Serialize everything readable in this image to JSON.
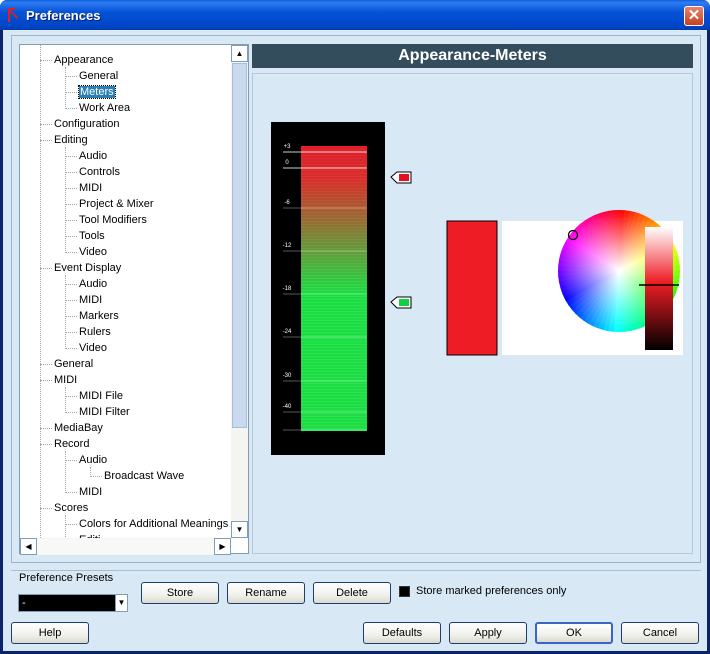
{
  "window": {
    "title": "Preferences",
    "close_symbol": "✕"
  },
  "tree": {
    "items": [
      {
        "label": "Appearance",
        "level": 1,
        "selected": false
      },
      {
        "label": "General",
        "level": 2,
        "selected": false
      },
      {
        "label": "Meters",
        "level": 2,
        "selected": true
      },
      {
        "label": "Work Area",
        "level": 2,
        "selected": false
      },
      {
        "label": "Configuration",
        "level": 1,
        "selected": false
      },
      {
        "label": "Editing",
        "level": 1,
        "selected": false
      },
      {
        "label": "Audio",
        "level": 2,
        "selected": false
      },
      {
        "label": "Controls",
        "level": 2,
        "selected": false
      },
      {
        "label": "MIDI",
        "level": 2,
        "selected": false
      },
      {
        "label": "Project & Mixer",
        "level": 2,
        "selected": false
      },
      {
        "label": "Tool Modifiers",
        "level": 2,
        "selected": false
      },
      {
        "label": "Tools",
        "level": 2,
        "selected": false
      },
      {
        "label": "Video",
        "level": 2,
        "selected": false
      },
      {
        "label": "Event Display",
        "level": 1,
        "selected": false
      },
      {
        "label": "Audio",
        "level": 2,
        "selected": false
      },
      {
        "label": "MIDI",
        "level": 2,
        "selected": false
      },
      {
        "label": "Markers",
        "level": 2,
        "selected": false
      },
      {
        "label": "Rulers",
        "level": 2,
        "selected": false
      },
      {
        "label": "Video",
        "level": 2,
        "selected": false
      },
      {
        "label": "General",
        "level": 1,
        "selected": false
      },
      {
        "label": "MIDI",
        "level": 1,
        "selected": false
      },
      {
        "label": "MIDI File",
        "level": 2,
        "selected": false
      },
      {
        "label": "MIDI Filter",
        "level": 2,
        "selected": false
      },
      {
        "label": "MediaBay",
        "level": 1,
        "selected": false
      },
      {
        "label": "Record",
        "level": 1,
        "selected": false
      },
      {
        "label": "Audio",
        "level": 2,
        "selected": false
      },
      {
        "label": "Broadcast Wave",
        "level": 3,
        "selected": false
      },
      {
        "label": "MIDI",
        "level": 2,
        "selected": false
      },
      {
        "label": "Scores",
        "level": 1,
        "selected": false
      },
      {
        "label": "Colors for Additional Meanings",
        "level": 2,
        "selected": false
      },
      {
        "label": "Editi",
        "level": 2,
        "selected": false
      }
    ]
  },
  "section": {
    "title": "Appearance-Meters"
  },
  "meter": {
    "scale_labels": [
      "+3",
      "0",
      "-6",
      "-12",
      "-18",
      "-24",
      "-30",
      "-40"
    ],
    "top_color": "#e8222e",
    "bottom_color": "#22e84a",
    "handles": [
      {
        "name": "top",
        "color": "#e81020"
      },
      {
        "name": "bottom",
        "color": "#10d040"
      }
    ]
  },
  "color_picker": {
    "selected_color": "#ee1c25",
    "wheel_icon": "color-wheel",
    "brightness_level": 0.48
  },
  "presets": {
    "label": "Preference Presets",
    "current_value": "-",
    "store_label": "Store",
    "rename_label": "Rename",
    "delete_label": "Delete",
    "store_marked_label": "Store marked preferences only",
    "store_marked_checked": true
  },
  "footer": {
    "help_label": "Help",
    "defaults_label": "Defaults",
    "apply_label": "Apply",
    "ok_label": "OK",
    "cancel_label": "Cancel"
  }
}
